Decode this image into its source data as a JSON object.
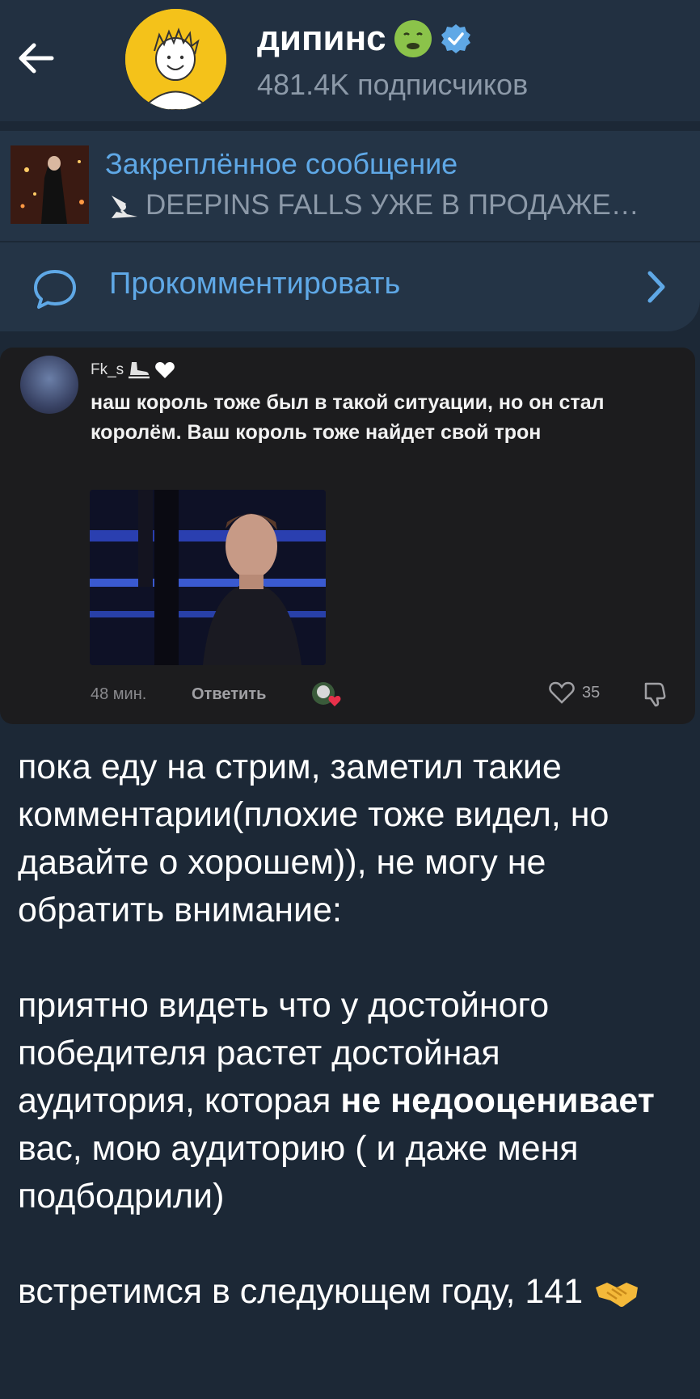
{
  "header": {
    "channel_name": "дипинс",
    "subscribers": "481.4K подписчиков",
    "icons": [
      "back-arrow-icon",
      "channel-avatar",
      "nauseated-face-emoji",
      "verified-badge-icon"
    ]
  },
  "pinned": {
    "title": "Закреплённое сообщение",
    "text": "DEEPINS FALLS УЖЕ В ПРОДАЖЕ…"
  },
  "comment_bar": {
    "label": "Прокомментировать"
  },
  "screenshot_comment": {
    "username": "Fk_s",
    "text": "наш король тоже был в такой ситуации, но он стал королём. Ваш король тоже найдет свой трон",
    "time": "48 мин.",
    "reply_label": "Ответить",
    "likes": "35"
  },
  "post": {
    "p1": "пока еду на стрим, заметил такие комментарии(плохие тоже видел, но давайте о хорошем)), не могу не обратить внимание:",
    "p2_before": "приятно видеть что у достойного победителя растет достойная аудитория, которая ",
    "p2_bold": "не недооценивает",
    "p2_after": " вас, мою аудиторию ( и даже меня подбодрили)",
    "p3": "встретимся в следующем году, 141"
  },
  "colors": {
    "background": "#1c2836",
    "header": "#223041",
    "accent": "#5fa8e6",
    "muted": "#8c99a8"
  }
}
